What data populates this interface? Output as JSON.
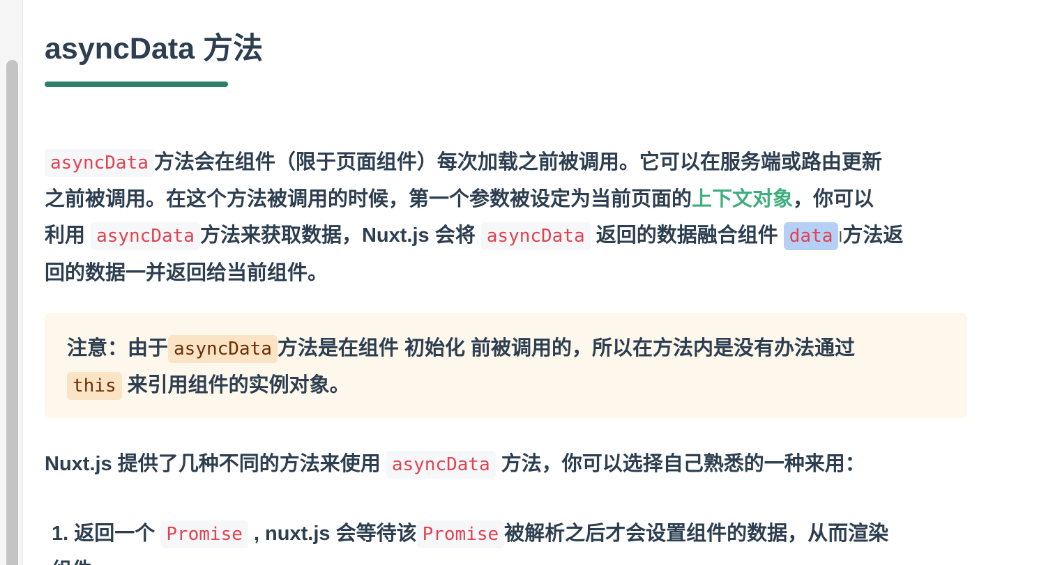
{
  "scrollbar": {},
  "heading": {
    "title": "asyncData 方法"
  },
  "paragraph1": {
    "code_asyncdata": "asyncData",
    "t1": "方法会在组件（限于页面组件）每次加载之前被调用。它可以在服务端或路由更新",
    "t2": "之前被调用。在这个方法被调用的时候，第一个参数被设定为当前页面的",
    "link_context": "上下文对象",
    "t3": "，你可以",
    "t4": "利用 ",
    "t5": "方法来获取数据，Nuxt.js 会将 ",
    "t6": " 返回的数据融合组件 ",
    "code_data": "data",
    "t7": "方法返",
    "t8": "回的数据一并返回给当前组件。"
  },
  "tip": {
    "t1": "注意：由于",
    "code_asyncdata": "asyncData",
    "t2": "方法是在组件 初始化 前被调用的，所以在方法内是没有办法通过",
    "code_this": "this",
    "t3": " 来引用组件的实例对象。"
  },
  "paragraph2": {
    "t1": "Nuxt.js 提供了几种不同的方法来使用 ",
    "code_asyncdata": "asyncData",
    "t2": " 方法，你可以选择自己熟悉的一种来用："
  },
  "list": {
    "item1": {
      "number": "1.",
      "t1": " 返回一个 ",
      "code_promise": "Promise",
      "t2": " , nuxt.js 会等待该",
      "t3": "被解析之后才会设置组件的数据，从而渲染",
      "t4": "组件"
    }
  }
}
